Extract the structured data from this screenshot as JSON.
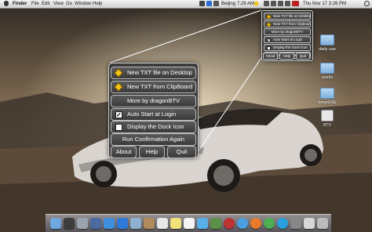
{
  "menubar": {
    "app_name": "Finder",
    "menus": [
      "File",
      "Edit",
      "View",
      "Go",
      "Window",
      "Help"
    ],
    "city": "Beijing",
    "clock": "7:26 AM",
    "date_time": "Thu Nov 17  3:26 PM"
  },
  "popup_large": {
    "items": [
      {
        "label": "New TXT file on Desktop",
        "icon": "yellow-diamond-icon"
      },
      {
        "label": "New TXT from ClipBoard",
        "icon": "yellow-diamond-icon"
      },
      {
        "label": "More by dragonBTV"
      },
      {
        "label": "Auto Start at Login",
        "checked": true
      },
      {
        "label": "Display the Dock Icon",
        "checked": false
      },
      {
        "label": "Run Confirmation Again"
      }
    ],
    "buttons": [
      "About",
      "Help",
      "Quit"
    ]
  },
  "popup_small": {
    "items": [
      {
        "label": "New TXT file on Desktop",
        "icon": "yellow-diamond-icon"
      },
      {
        "label": "New TXT from Clipboard",
        "icon": "yellow-diamond-icon"
      },
      {
        "label": "More by dragonBTV"
      },
      {
        "label": "Auto Start at Login",
        "checked": true
      },
      {
        "label": "Display the Dock Icon",
        "checked": false
      },
      {
        "label": "Run Confirmation Again"
      }
    ],
    "buttons": [
      "About",
      "Help",
      "Quit"
    ]
  },
  "desktop_icons": [
    {
      "label": "daily use",
      "icon": "folder-icon"
    },
    {
      "label": "works",
      "icon": "folder-icon"
    },
    {
      "label": "tempUSE",
      "icon": "folder-icon"
    },
    {
      "label": "8TV",
      "icon": "app-icon"
    }
  ],
  "dock_icons": [
    "finder-icon",
    "dashboard-icon",
    "launchpad-icon",
    "mission-control-icon",
    "app-store-icon",
    "safari-icon",
    "mail-icon",
    "contacts-icon",
    "calendar-icon",
    "notes-icon",
    "reminders-icon",
    "messages-icon",
    "facetime-icon",
    "photo-booth-icon",
    "itunes-icon",
    "firefox-icon",
    "chrome-icon",
    "skype-icon",
    "system-preferences-icon",
    "textedit-icon",
    "trash-icon"
  ],
  "colors": {
    "accent_yellow": "#f3c416",
    "menu_panel": "#373737"
  }
}
